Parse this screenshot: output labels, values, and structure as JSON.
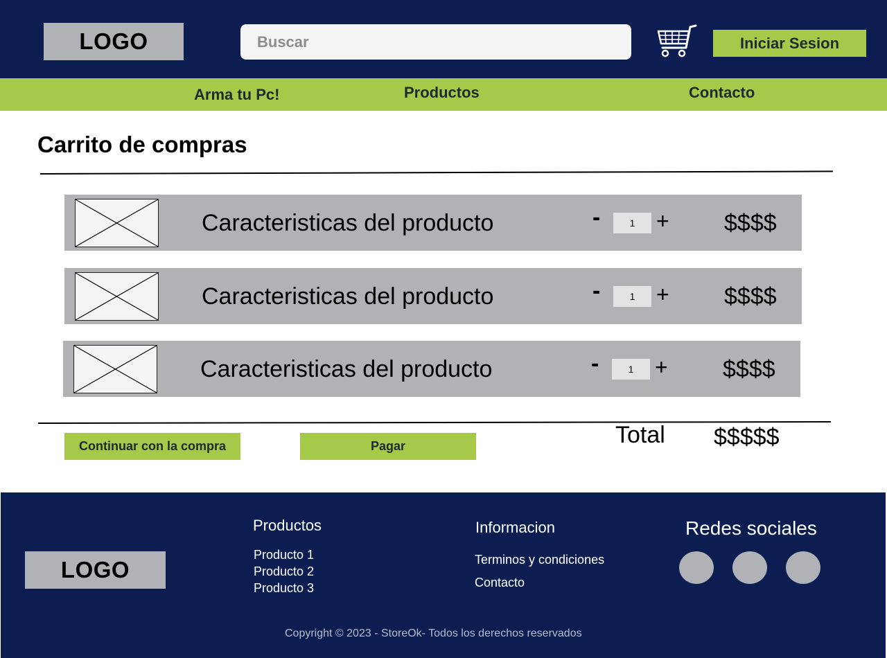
{
  "header": {
    "logo": "LOGO",
    "search_placeholder": "Buscar",
    "cart_icon": "shopping-cart-icon",
    "login_label": "Iniciar Sesion"
  },
  "nav": {
    "items": [
      {
        "label": "Arma tu Pc!"
      },
      {
        "label": "Productos"
      },
      {
        "label": "Contacto"
      }
    ]
  },
  "cart": {
    "title": "Carrito de compras",
    "items": [
      {
        "image_icon": "image-placeholder-icon",
        "description": "Caracteristicas del producto",
        "minus": "-",
        "quantity": "1",
        "plus": "+",
        "price": "$$$$"
      },
      {
        "image_icon": "image-placeholder-icon",
        "description": "Caracteristicas del producto",
        "minus": "-",
        "quantity": "1",
        "plus": "+",
        "price": "$$$$"
      },
      {
        "image_icon": "image-placeholder-icon",
        "description": "Caracteristicas del producto",
        "minus": "-",
        "quantity": "1",
        "plus": "+",
        "price": "$$$$"
      }
    ],
    "continue_label": "Continuar con la compra",
    "pay_label": "Pagar",
    "total_label": "Total",
    "total_value": "$$$$$"
  },
  "footer": {
    "logo": "LOGO",
    "products": {
      "heading": "Productos",
      "links": [
        "Producto 1",
        "Producto 2",
        "Producto 3"
      ]
    },
    "info": {
      "heading": "Informacion",
      "links": [
        "Terminos y condiciones",
        "Contacto"
      ]
    },
    "social": {
      "heading": "Redes sociales",
      "icons": [
        "social-icon-1",
        "social-icon-2",
        "social-icon-3"
      ]
    },
    "copyright": "Copyright © 2023 - StoreOk- Todos los derechos reservados"
  },
  "colors": {
    "navy": "#0b1d51",
    "green": "#a6c94a",
    "gray": "#b0b2b6"
  }
}
